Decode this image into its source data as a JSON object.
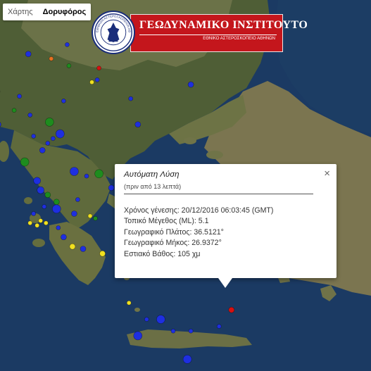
{
  "map_controls": {
    "map_label": "Χάρτης",
    "satellite_label": "Δορυφόρος",
    "active": "Δορυφόρος"
  },
  "logo": {
    "title": "ΓΕΩΔΥΝΑΜΙΚΟ ΙΝΣΤΙΤΟΥΤΟ",
    "subtitle": "ΕΘΝΙΚΟ ΑΣΤΕΡΟΣΚΟΠΕΙΟ ΑΘΗΝΩΝ",
    "seal_text": "ΕΘΝΙΚΟΝ ΑΣΤΕΡΟΣΚΟΠΕΙΟΝ ΑΘΗΝΩΝ"
  },
  "popup": {
    "heading": "Αυτόματη Λύση",
    "ago": "(πριν από 13 λεπτά)",
    "close": "×",
    "rows": [
      "Χρόνος γένεσης: 20/12/2016  06:03:45 (GMT)",
      "Τοπικό Μέγεθος (ML): 5.1",
      "Γεωγραφικό Πλάτος: 36.5121°",
      "Γεωγραφικό Μήκος: 26.9372°",
      "Εστιακό Βάθος: 105 χμ"
    ]
  },
  "colors": {
    "sea": "#1b3a63",
    "land": "#5d6a3e",
    "marker_blue": "#1e2fe0",
    "marker_green": "#1e8c1e",
    "marker_yellow": "#f0e020",
    "marker_orange": "#e87020",
    "marker_red": "#d81010",
    "epicenter": "#e0141c"
  },
  "markers": [
    {
      "color": "blue",
      "r": 4,
      "lat": 40.75,
      "lon": 20.45
    },
    {
      "color": "blue",
      "r": 3,
      "lat": 40.95,
      "lon": 21.55
    },
    {
      "color": "green",
      "r": 3,
      "lat": 40.5,
      "lon": 21.6
    },
    {
      "color": "orange",
      "r": 3,
      "lat": 40.65,
      "lon": 21.1
    },
    {
      "color": "yellow",
      "r": 3,
      "lat": 40.15,
      "lon": 22.25
    },
    {
      "color": "blue",
      "r": 3,
      "lat": 40.2,
      "lon": 22.4
    },
    {
      "color": "red",
      "r": 3,
      "lat": 40.45,
      "lon": 22.45
    },
    {
      "color": "blue",
      "r": 3,
      "lat": 39.75,
      "lon": 21.45
    },
    {
      "color": "blue",
      "r": 5,
      "lat": 39.95,
      "lon": 19.55
    },
    {
      "color": "blue",
      "r": 3,
      "lat": 39.85,
      "lon": 20.2
    },
    {
      "color": "green",
      "r": 3,
      "lat": 39.55,
      "lon": 20.05
    },
    {
      "color": "blue",
      "r": 3,
      "lat": 39.8,
      "lon": 23.35
    },
    {
      "color": "blue",
      "r": 4,
      "lat": 39.25,
      "lon": 23.55
    },
    {
      "color": "blue",
      "r": 4,
      "lat": 39.25,
      "lon": 19.6
    },
    {
      "color": "blue",
      "r": 3,
      "lat": 39.45,
      "lon": 20.5
    },
    {
      "color": "green",
      "r": 6,
      "lat": 39.3,
      "lon": 21.05
    },
    {
      "color": "blue",
      "r": 6,
      "lat": 39.05,
      "lon": 21.35
    },
    {
      "color": "blue",
      "r": 3,
      "lat": 38.95,
      "lon": 21.15
    },
    {
      "color": "blue",
      "r": 3,
      "lat": 39.0,
      "lon": 20.6
    },
    {
      "color": "blue",
      "r": 3,
      "lat": 38.85,
      "lon": 21.0
    },
    {
      "color": "blue",
      "r": 5,
      "lat": 38.75,
      "lon": 19.3
    },
    {
      "color": "blue",
      "r": 4,
      "lat": 38.7,
      "lon": 20.85
    },
    {
      "color": "green",
      "r": 6,
      "lat": 38.45,
      "lon": 20.35
    },
    {
      "color": "blue",
      "r": 6,
      "lat": 38.25,
      "lon": 21.75
    },
    {
      "color": "blue",
      "r": 3,
      "lat": 38.15,
      "lon": 22.1
    },
    {
      "color": "green",
      "r": 6,
      "lat": 38.2,
      "lon": 22.45
    },
    {
      "color": "blue",
      "r": 5,
      "lat": 38.05,
      "lon": 20.7
    },
    {
      "color": "blue",
      "r": 3,
      "lat": 38.05,
      "lon": 23.0
    },
    {
      "color": "blue",
      "r": 4,
      "lat": 37.9,
      "lon": 22.8
    },
    {
      "color": "blue",
      "r": 5,
      "lat": 37.85,
      "lon": 20.8
    },
    {
      "color": "green",
      "r": 4,
      "lat": 37.75,
      "lon": 21.0
    },
    {
      "color": "green",
      "r": 4,
      "lat": 37.6,
      "lon": 21.25
    },
    {
      "color": "blue",
      "r": 3,
      "lat": 37.65,
      "lon": 21.85
    },
    {
      "color": "blue",
      "r": 6,
      "lat": 37.45,
      "lon": 21.25
    },
    {
      "color": "blue",
      "r": 3,
      "lat": 37.5,
      "lon": 20.9
    },
    {
      "color": "blue",
      "r": 3,
      "lat": 37.35,
      "lon": 20.6
    },
    {
      "color": "blue",
      "r": 4,
      "lat": 37.35,
      "lon": 21.75
    },
    {
      "color": "yellow",
      "r": 3,
      "lat": 37.3,
      "lon": 22.2
    },
    {
      "color": "yellow",
      "r": 3,
      "lat": 37.2,
      "lon": 20.8
    },
    {
      "color": "yellow",
      "r": 3,
      "lat": 37.15,
      "lon": 20.95
    },
    {
      "color": "yellow",
      "r": 3,
      "lat": 37.15,
      "lon": 20.5
    },
    {
      "color": "yellow",
      "r": 3,
      "lat": 37.1,
      "lon": 20.7
    },
    {
      "color": "blue",
      "r": 3,
      "lat": 37.05,
      "lon": 21.3
    },
    {
      "color": "blue",
      "r": 4,
      "lat": 36.85,
      "lon": 21.45
    },
    {
      "color": "yellow",
      "r": 4,
      "lat": 36.65,
      "lon": 21.7
    },
    {
      "color": "blue",
      "r": 4,
      "lat": 36.6,
      "lon": 22.0
    },
    {
      "color": "yellow",
      "r": 4,
      "lat": 36.5,
      "lon": 22.55
    },
    {
      "color": "green",
      "r": 3,
      "lat": 37.25,
      "lon": 22.35
    },
    {
      "color": "blue",
      "r": 4,
      "lat": 36.25,
      "lon": 23.05
    },
    {
      "color": "blue",
      "r": 3,
      "lat": 36.75,
      "lon": 23.2
    },
    {
      "color": "yellow",
      "r": 3,
      "lat": 35.45,
      "lon": 23.3
    },
    {
      "color": "blue",
      "r": 6,
      "lat": 35.1,
      "lon": 24.2
    },
    {
      "color": "blue",
      "r": 6,
      "lat": 34.75,
      "lon": 23.55
    },
    {
      "color": "blue",
      "r": 3,
      "lat": 35.1,
      "lon": 23.8
    },
    {
      "color": "blue",
      "r": 3,
      "lat": 34.85,
      "lon": 24.55
    },
    {
      "color": "blue",
      "r": 3,
      "lat": 34.85,
      "lon": 25.05
    },
    {
      "color": "blue",
      "r": 3,
      "lat": 34.95,
      "lon": 25.85
    },
    {
      "color": "red",
      "r": 4,
      "lat": 35.3,
      "lon": 26.2
    },
    {
      "color": "blue",
      "r": 6,
      "lat": 34.25,
      "lon": 24.95
    },
    {
      "color": "blue",
      "r": 4,
      "lat": 36.25,
      "lon": 24.45
    },
    {
      "color": "blue",
      "r": 4,
      "lat": 40.1,
      "lon": 25.05
    },
    {
      "color": "blue",
      "r": 3,
      "lat": 37.85,
      "lon": 25.7
    },
    {
      "color": "blue",
      "r": 4,
      "lat": 37.0,
      "lon": 26.25
    },
    {
      "color": "blue",
      "r": 3,
      "lat": 36.05,
      "lon": 23.35
    }
  ],
  "epicenter": {
    "lat": 36.5121,
    "lon": 26.9372
  }
}
